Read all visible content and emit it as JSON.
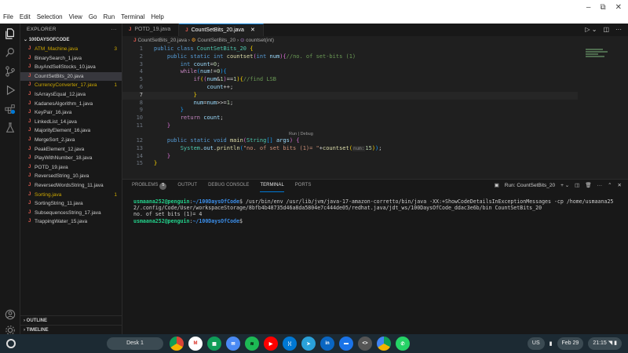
{
  "menu": [
    "File",
    "Edit",
    "Selection",
    "View",
    "Go",
    "Run",
    "Terminal",
    "Help"
  ],
  "window_controls": [
    "–",
    "⧉",
    "✕"
  ],
  "explorer": {
    "header": "EXPLORER",
    "folder": "100DAYSOFCODE",
    "files": [
      {
        "name": "ATM_Machine.java",
        "warn": true,
        "badge": "3"
      },
      {
        "name": "BinarySearch_1.java"
      },
      {
        "name": "BuyAndSellStocks_10.java"
      },
      {
        "name": "CountSetBits_20.java",
        "active": true
      },
      {
        "name": "CurrencyConverter_17.java",
        "warn": true,
        "badge": "1"
      },
      {
        "name": "IsArraysEqual_12.java"
      },
      {
        "name": "KadanesAlgorithm_1.java"
      },
      {
        "name": "KeyPair_16.java"
      },
      {
        "name": "LinkedList_14.java"
      },
      {
        "name": "MajorityElement_16.java"
      },
      {
        "name": "MergeSort_2.java"
      },
      {
        "name": "PeakElement_12.java"
      },
      {
        "name": "PlayWithNumber_18.java"
      },
      {
        "name": "POTD_19.java"
      },
      {
        "name": "ReversedString_10.java"
      },
      {
        "name": "ReversedWordsString_11.java"
      },
      {
        "name": "Sorting.java",
        "warn": true,
        "badge": "1"
      },
      {
        "name": "SortingString_11.java"
      },
      {
        "name": "SubsequencesString_17.java"
      },
      {
        "name": "TrappingWater_15.java"
      }
    ],
    "outline": "OUTLINE",
    "timeline": "TIMELINE"
  },
  "tabs": [
    {
      "label": "POTD_19.java"
    },
    {
      "label": "CountSetBits_20.java",
      "active": true
    }
  ],
  "breadcrumb": {
    "file": "CountSetBits_20.java",
    "class": "CountSetBits_20",
    "method": "countset(int)"
  },
  "code": {
    "codelens": "Run | Debug",
    "line_numbers": [
      "1",
      "2",
      "3",
      "4",
      "5",
      "6",
      "7",
      "8",
      "9",
      "10",
      "11",
      "12",
      "13",
      "14",
      "15"
    ]
  },
  "panel": {
    "tabs": [
      "PROBLEMS",
      "OUTPUT",
      "DEBUG CONSOLE",
      "TERMINAL",
      "PORTS"
    ],
    "problems_count": "5",
    "run_label": "Run: CountSetBits_20",
    "terminal": {
      "prompt": "usmaana252@penguin",
      "path": "~/100DaysOfCode",
      "command": " /usr/bin/env /usr/lib/jvm/java-17-amazon-corretto/bin/java -XX:+ShowCodeDetailsInExceptionMessages -cp /home/usmaana252/.config/Code/User/workspaceStorage/8bfb4b48735d46a8da5804e7c444de05/redhat.java/jdt_ws/100DaysOfCode_ddac3e6b/bin CountSetBits_20",
      "output": "no. of set bits (1)= 4"
    }
  },
  "taskbar": {
    "desk": "Desk 1",
    "lang": "US",
    "date": "Feb 29",
    "time": "21:15"
  }
}
